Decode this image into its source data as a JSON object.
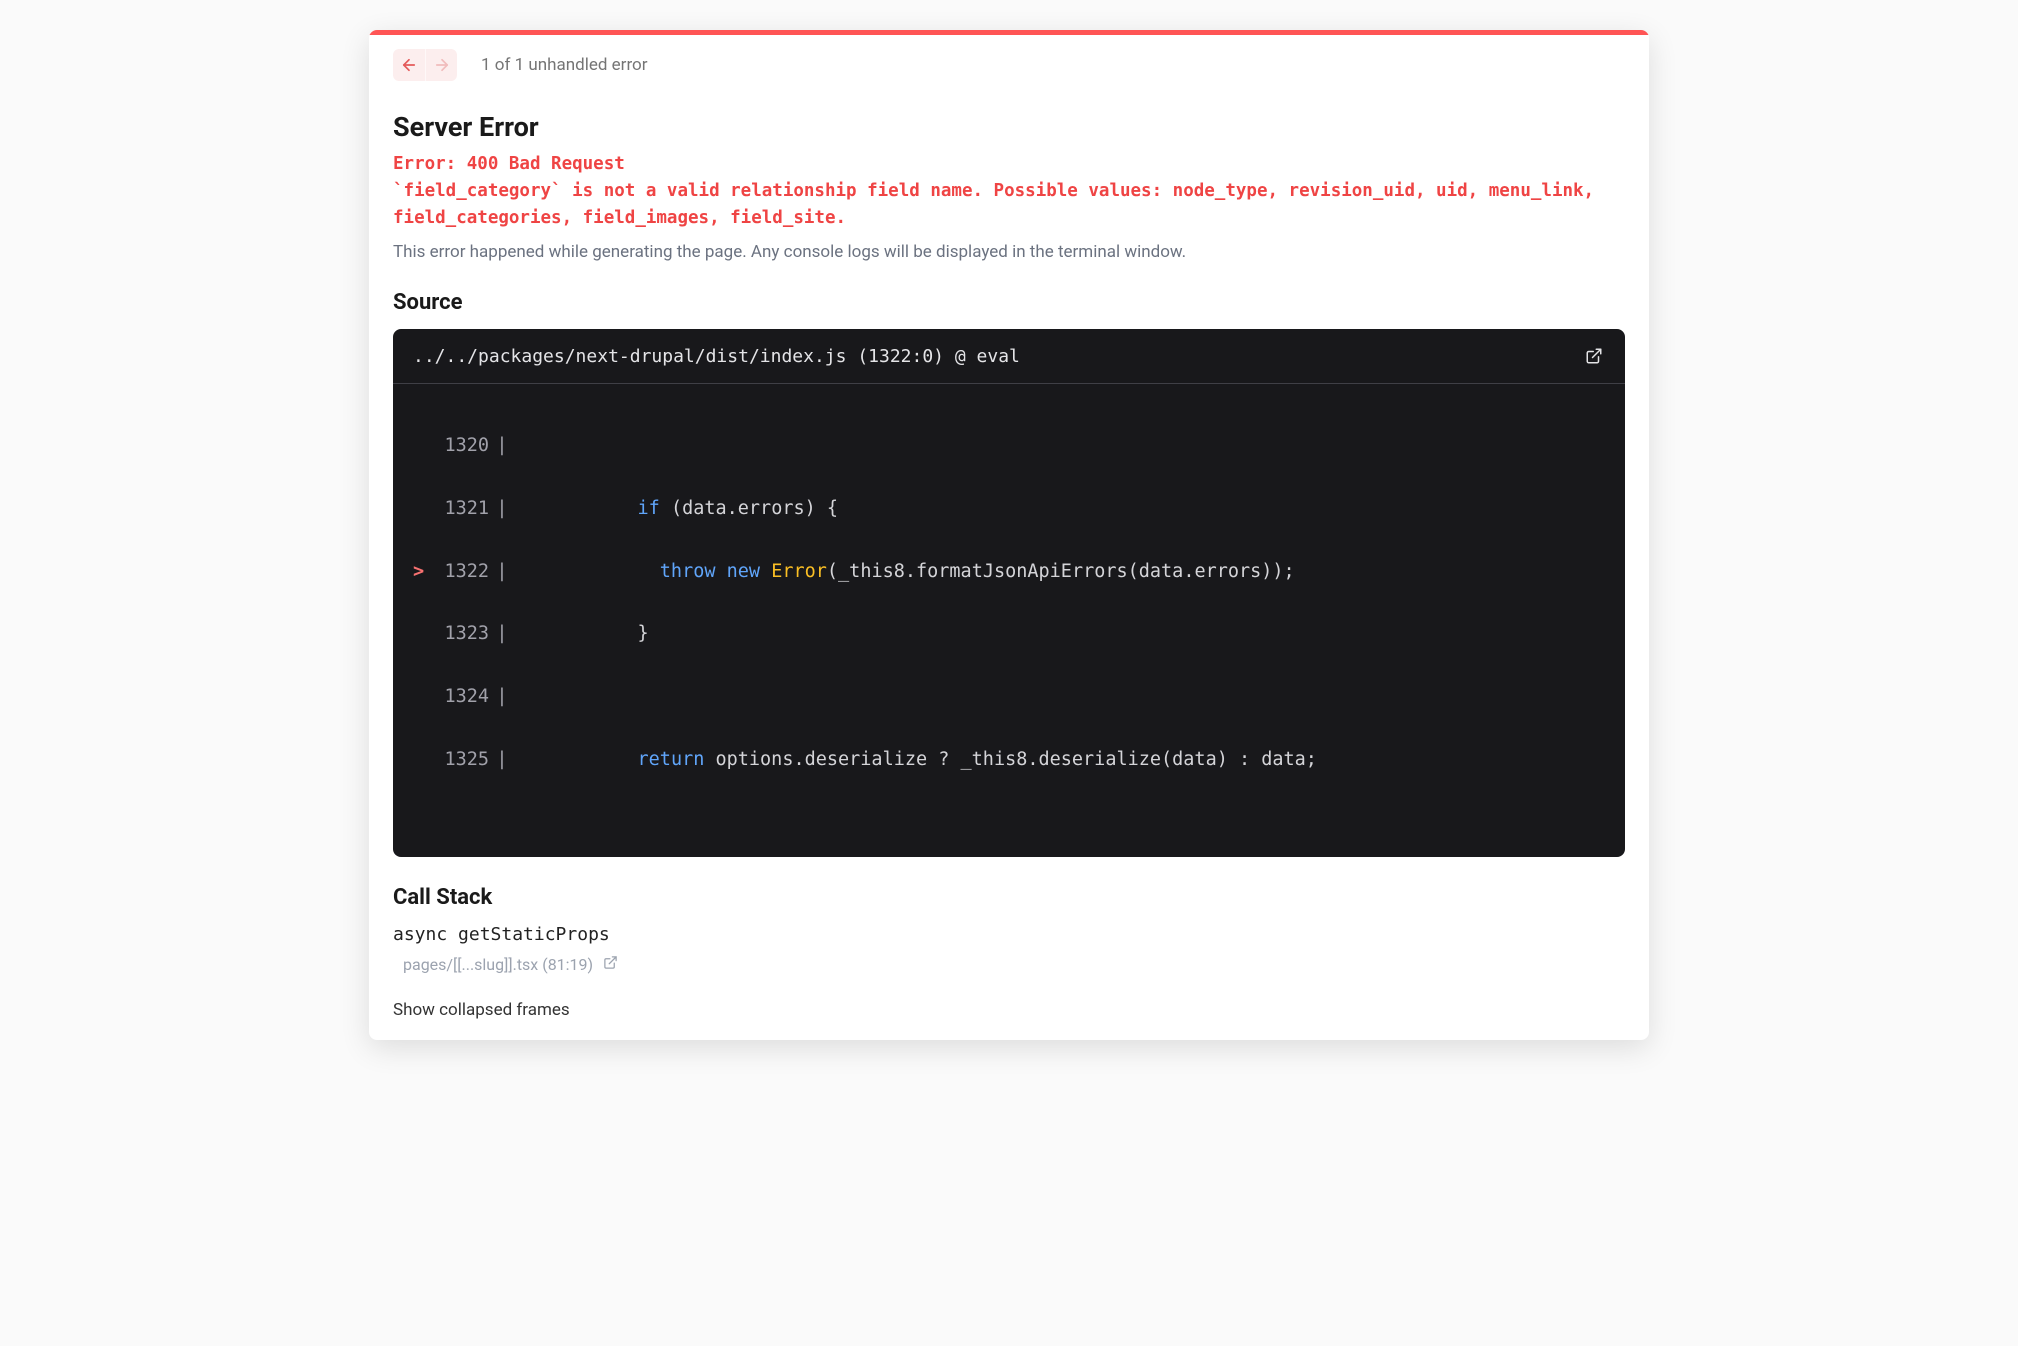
{
  "header": {
    "counter": "1 of 1 unhandled error"
  },
  "error": {
    "title": "Server Error",
    "message": "Error: 400 Bad Request\n`field_category` is not a valid relationship field name. Possible values: node_type, revision_uid, uid, menu_link, field_categories, field_images, field_site.",
    "description": "This error happened while generating the page. Any console logs will be displayed in the terminal window."
  },
  "source": {
    "heading": "Source",
    "location": "../../packages/next-drupal/dist/index.js (1322:0) @ eval",
    "lines": {
      "l1320": "1320",
      "l1321": "1321",
      "l1322": "1322",
      "l1323": "1323",
      "l1324": "1324",
      "l1325": "1325"
    },
    "code": {
      "t1321_if": "if",
      "t1321_rest": " (data.errors) {",
      "t1322_throw": "throw",
      "t1322_new": "new",
      "t1322_error": "Error",
      "t1322_rest": "(_this8.formatJsonApiErrors(data.errors));",
      "t1323": "}",
      "t1325_return": "return",
      "t1325_rest": " options.deserialize ? _this8.deserialize(data) : data;"
    }
  },
  "callstack": {
    "heading": "Call Stack",
    "frame_fn": "async getStaticProps",
    "frame_loc": "pages/[[...slug]].tsx (81:19)",
    "show_collapsed": "Show collapsed frames"
  }
}
